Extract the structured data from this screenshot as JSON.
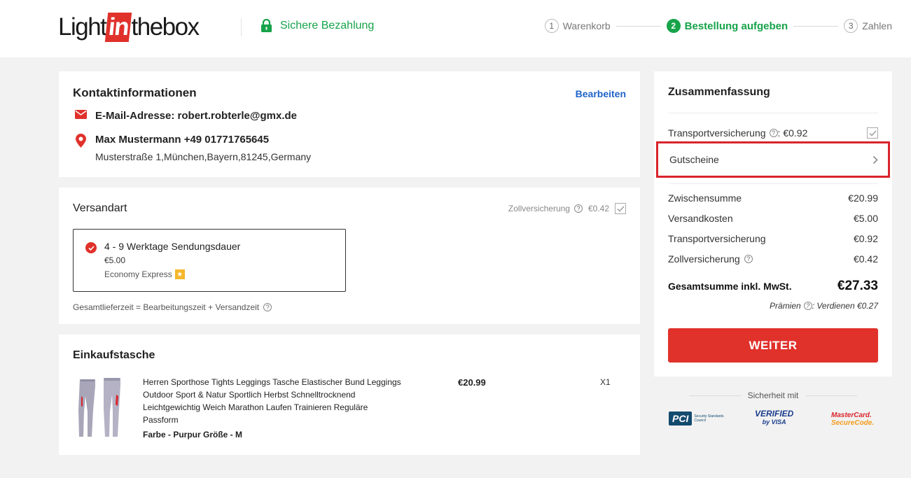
{
  "header": {
    "logo": {
      "part1": "Light",
      "part2": "in",
      "part3": "thebox"
    },
    "secure_label": "Sichere Bezahlung",
    "steps": [
      {
        "num": "1",
        "label": "Warenkorb"
      },
      {
        "num": "2",
        "label": "Bestellung aufgeben"
      },
      {
        "num": "3",
        "label": "Zahlen"
      }
    ]
  },
  "contact": {
    "title": "Kontaktinformationen",
    "edit_label": "Bearbeiten",
    "email_line": "E-Mail-Adresse: robert.robterle@gmx.de",
    "name_phone": "Max Mustermann +49 01771765645",
    "address": "Musterstraße 1,München,Bayern,81245,Germany"
  },
  "shipping": {
    "title": "Versandart",
    "customs_label": "Zollversicherung",
    "customs_price": "€0.42",
    "option": {
      "title": "4 - 9 Werktage Sendungsdauer",
      "price": "€5.00",
      "carrier": "Economy Express"
    },
    "total_time_note": "Gesamtlieferzeit = Bearbeitungszeit + Versandzeit"
  },
  "bag": {
    "title": "Einkaufstasche",
    "product": {
      "name": "Herren Sporthose Tights Leggings Tasche Elastischer Bund Leggings Outdoor Sport & Natur Sportlich Herbst Schnelltrocknend Leichtgewichtig Weich Marathon Laufen Trainieren Reguläre Passform",
      "attributes": "Farbe - Purpur  Größe - M",
      "price": "€20.99",
      "qty": "X1"
    }
  },
  "summary": {
    "title": "Zusammenfassung",
    "transport_insurance_label": "Transportversicherung",
    "transport_insurance_value": ": €0.92",
    "coupon_label": "Gutscheine",
    "lines": [
      {
        "label": "Zwischensumme",
        "value": "€20.99"
      },
      {
        "label": "Versandkosten",
        "value": "€5.00"
      },
      {
        "label": "Transportversicherung",
        "value": "€0.92"
      },
      {
        "label": "Zollversicherung",
        "value": "€0.42"
      }
    ],
    "grand_label": "Gesamtsumme inkl. MwSt.",
    "grand_value": "€27.33",
    "points_label": "Prämien",
    "points_value": ": Verdienen €0.27",
    "continue_label": "WEITER"
  },
  "security": {
    "title": "Sicherheit mit",
    "pci": "PCI",
    "pci_sub": "Security Standards Council",
    "visa_1": "VERIFIED",
    "visa_2": "by VISA",
    "mc_1": "MasterCard.",
    "mc_2": "SecureCode."
  },
  "colors": {
    "accent_red": "#e0312b",
    "green": "#17a34a",
    "link_blue": "#1e63c9"
  }
}
